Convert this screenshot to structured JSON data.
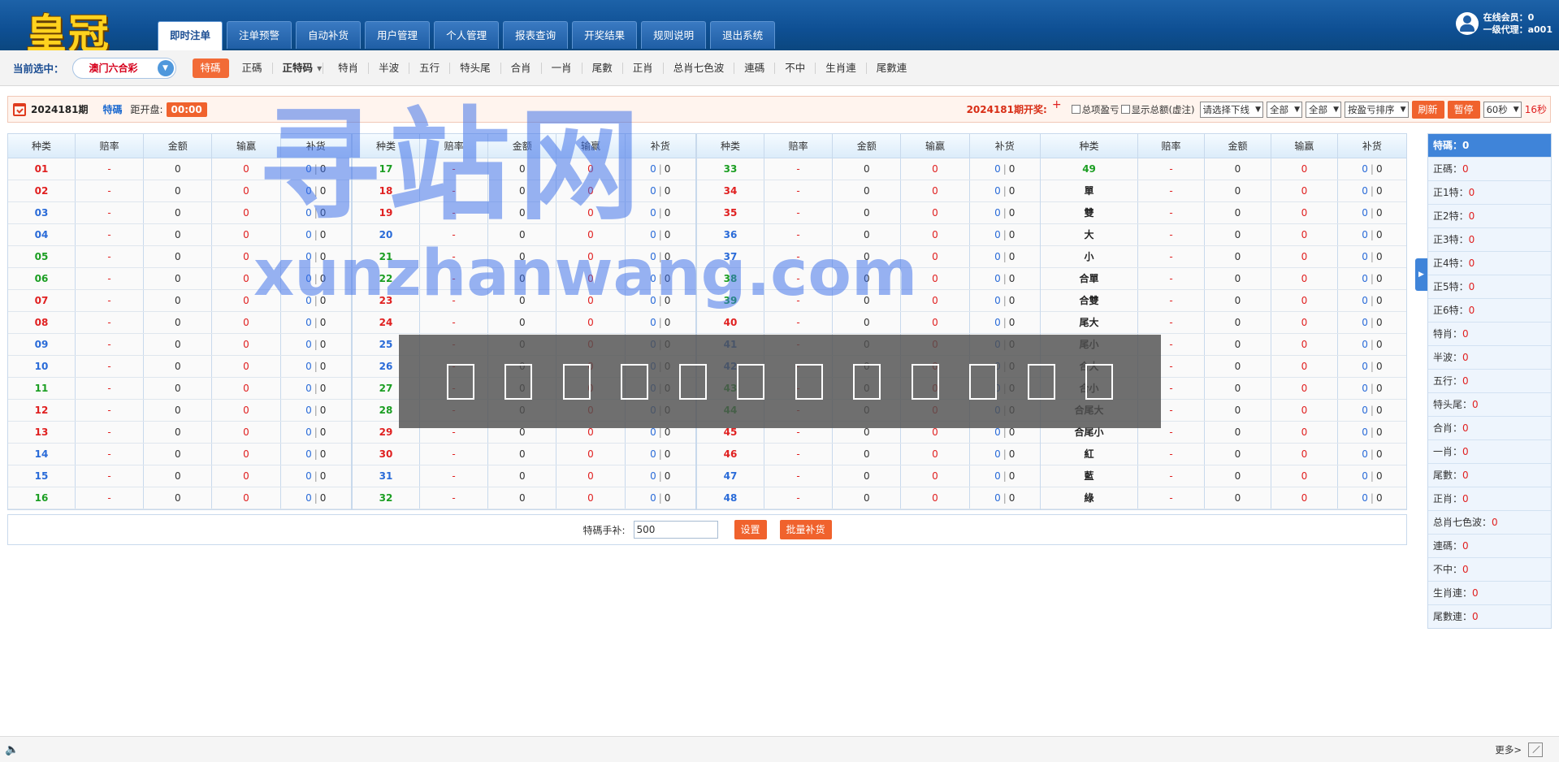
{
  "header": {
    "logo": "皇冠",
    "tabs": [
      "即时注单",
      "注单预警",
      "自动补货",
      "用户管理",
      "个人管理",
      "报表查询",
      "开奖结果",
      "规则说明",
      "退出系统"
    ],
    "active_tab": 0,
    "online_members": "在线会员：0",
    "agent": "一级代理：a001"
  },
  "subbar": {
    "current_label": "当前选中：",
    "game": "澳门六合彩",
    "items": [
      "特碼",
      "正碼",
      "正特码",
      "特肖",
      "半波",
      "五行",
      "特头尾",
      "合肖",
      "一肖",
      "尾數",
      "正肖",
      "总肖七色波",
      "連碼",
      "不中",
      "生肖連",
      "尾數連"
    ]
  },
  "info": {
    "issue": "2024181期",
    "mode": "特碼",
    "countdown_label": "距开盘:",
    "countdown": "00:00",
    "draw_issue": "2024181",
    "draw_label": "期开奖:",
    "plus": "+",
    "chk1": "总项盈亏",
    "chk2": "显示总额(虚注)",
    "sel1": "请选择下线",
    "sel2": "全部",
    "sel3": "全部",
    "sel4": "按盈亏排序",
    "btn_refresh": "刷新",
    "btn_pause": "暂停",
    "sel5": "60秒",
    "seconds": "16秒"
  },
  "table": {
    "headers": [
      "种类",
      "赔率",
      "金额",
      "输赢",
      "补货"
    ],
    "blocks": [
      [
        [
          "01",
          "red"
        ],
        [
          "02",
          "red"
        ],
        [
          "03",
          "blue"
        ],
        [
          "04",
          "blue"
        ],
        [
          "05",
          "green"
        ],
        [
          "06",
          "green"
        ],
        [
          "07",
          "red"
        ],
        [
          "08",
          "red"
        ],
        [
          "09",
          "blue"
        ],
        [
          "10",
          "blue"
        ],
        [
          "11",
          "green"
        ],
        [
          "12",
          "red"
        ],
        [
          "13",
          "red"
        ],
        [
          "14",
          "blue"
        ],
        [
          "15",
          "blue"
        ],
        [
          "16",
          "green"
        ]
      ],
      [
        [
          "17",
          "green"
        ],
        [
          "18",
          "red"
        ],
        [
          "19",
          "red"
        ],
        [
          "20",
          "blue"
        ],
        [
          "21",
          "green"
        ],
        [
          "22",
          "green"
        ],
        [
          "23",
          "red"
        ],
        [
          "24",
          "red"
        ],
        [
          "25",
          "blue"
        ],
        [
          "26",
          "blue"
        ],
        [
          "27",
          "green"
        ],
        [
          "28",
          "green"
        ],
        [
          "29",
          "red"
        ],
        [
          "30",
          "red"
        ],
        [
          "31",
          "blue"
        ],
        [
          "32",
          "green"
        ]
      ],
      [
        [
          "33",
          "green"
        ],
        [
          "34",
          "red"
        ],
        [
          "35",
          "red"
        ],
        [
          "36",
          "blue"
        ],
        [
          "37",
          "blue"
        ],
        [
          "38",
          "green"
        ],
        [
          "39",
          "green"
        ],
        [
          "40",
          "red"
        ],
        [
          "41",
          "blue"
        ],
        [
          "42",
          "blue"
        ],
        [
          "43",
          "green"
        ],
        [
          "44",
          "green"
        ],
        [
          "45",
          "red"
        ],
        [
          "46",
          "red"
        ],
        [
          "47",
          "blue"
        ],
        [
          "48",
          "blue"
        ]
      ],
      [
        [
          "49",
          "green"
        ],
        [
          "單",
          "dark"
        ],
        [
          "雙",
          "dark"
        ],
        [
          "大",
          "dark"
        ],
        [
          "小",
          "dark"
        ],
        [
          "合單",
          "dark"
        ],
        [
          "合雙",
          "dark"
        ],
        [
          "尾大",
          "dark"
        ],
        [
          "尾小",
          "dark"
        ],
        [
          "合大",
          "dark"
        ],
        [
          "合小",
          "dark"
        ],
        [
          "合尾大",
          "dark"
        ],
        [
          "合尾小",
          "dark"
        ],
        [
          "紅",
          "dark"
        ],
        [
          "藍",
          "dark"
        ],
        [
          "綠",
          "dark"
        ]
      ]
    ],
    "odds": "-",
    "amount": "0",
    "winloss": "0",
    "bh_a": "0",
    "bh_sep": "|",
    "bh_b": "0"
  },
  "bottom": {
    "label": "特碼手补:",
    "value": "500",
    "btn_set": "设置",
    "btn_batch": "批量补货"
  },
  "sidebar": {
    "head_label": "特碼：",
    "head_value": "0",
    "rows": [
      {
        "label": "正碼：",
        "value": "0"
      },
      {
        "label": "正1特：",
        "value": "0"
      },
      {
        "label": "正2特：",
        "value": "0"
      },
      {
        "label": "正3特：",
        "value": "0"
      },
      {
        "label": "正4特：",
        "value": "0"
      },
      {
        "label": "正5特：",
        "value": "0"
      },
      {
        "label": "正6特：",
        "value": "0"
      },
      {
        "label": "特肖：",
        "value": "0"
      },
      {
        "label": "半波：",
        "value": "0"
      },
      {
        "label": "五行：",
        "value": "0"
      },
      {
        "label": "特头尾：",
        "value": "0"
      },
      {
        "label": "合肖：",
        "value": "0"
      },
      {
        "label": "一肖：",
        "value": "0"
      },
      {
        "label": "尾數：",
        "value": "0"
      },
      {
        "label": "正肖：",
        "value": "0"
      },
      {
        "label": "总肖七色波：",
        "value": "0"
      },
      {
        "label": "連碼：",
        "value": "0"
      },
      {
        "label": "不中：",
        "value": "0"
      },
      {
        "label": "生肖連：",
        "value": "0"
      },
      {
        "label": "尾數連：",
        "value": "0"
      }
    ]
  },
  "footer": {
    "more": "更多>"
  },
  "watermark": {
    "cn": "寻站网",
    "en": "xunzhanwang.com"
  },
  "colors": {
    "accent": "#f0622d",
    "primary": "#1f5ea5",
    "red": "#e02020",
    "blue": "#2a6bd8",
    "green": "#1b9e22"
  }
}
